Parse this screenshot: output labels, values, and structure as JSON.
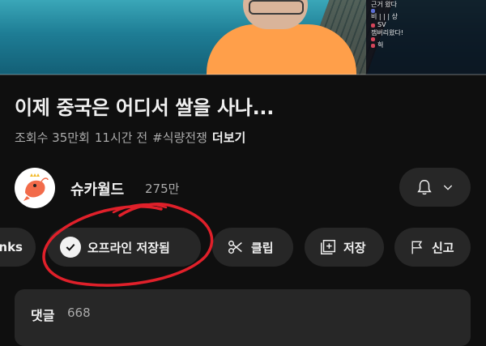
{
  "video": {
    "progress_percent": 0,
    "chat_lines": [
      {
        "text": "근거 왔다",
        "dot": ""
      },
      {
        "text": "",
        "dot": "blue"
      },
      {
        "text": "비 | | | 상",
        "dot": ""
      },
      {
        "text": "SV",
        "dot": "red"
      },
      {
        "text": "잼버리왔다!",
        "dot": ""
      },
      {
        "text": "",
        "dot": "red"
      },
      {
        "text": "헉",
        "dot": "red"
      }
    ]
  },
  "title": "이제 중국은 어디서 쌀을 사나...",
  "meta": {
    "views": "조회수 35만회",
    "time": "11시간 전",
    "hashtag": "#식량전쟁",
    "more": "더보기"
  },
  "channel": {
    "name": "슈카월드",
    "subscribers": "275만"
  },
  "actions": {
    "thanks": "nks",
    "offline": "오프라인 저장됨",
    "clip": "클립",
    "save": "저장",
    "report": "신고"
  },
  "comments": {
    "label": "댓글",
    "count": "668"
  },
  "colors": {
    "background": "#0f0f0f",
    "chip": "#272727",
    "annotation": "#e0202a",
    "avatar_shrimp": "#f26b4a"
  },
  "icons": [
    "check-circle-icon",
    "scissors-icon",
    "add-to-playlist-icon",
    "flag-icon",
    "bell-icon",
    "chevron-down-icon"
  ]
}
